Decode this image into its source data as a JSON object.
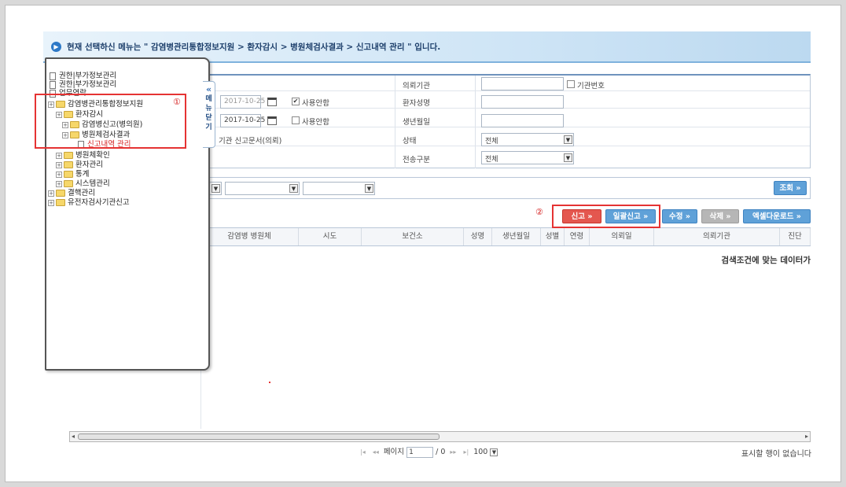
{
  "header": {
    "title": "현재 선택하신 메뉴는 \" 감염병관리통합정보지원 > 환자감시 > 병원체검사결과 > 신고내역 관리 \" 입니다."
  },
  "form": {
    "date1": "2017-10-25",
    "date2": "2017-10-25",
    "chk1_label": "사용안함",
    "chk2_label": "사용안함",
    "doc_label": "기관 신고문서(의뢰)",
    "fields": {
      "inst_label": "의뢰기관",
      "inst_code_label": "기관번호",
      "patient_name_label": "환자성명",
      "birth_label": "생년월일",
      "status_label": "상태",
      "status_value": "전체",
      "transfer_label": "전송구분",
      "transfer_value": "전체"
    }
  },
  "toolbar": {
    "search_label": "조회 »",
    "report_label": "신고 »",
    "batch_report_label": "일괄신고 »",
    "edit_label": "수정 »",
    "delete_label": "삭제 »",
    "excel_label": "엑셀다운로드 »"
  },
  "grid": {
    "columns": [
      "감염병 병원체",
      "시도",
      "보건소",
      "성명",
      "생년월일",
      "성별",
      "연령",
      "의뢰일",
      "의뢰기관",
      "진단"
    ],
    "empty_message": "검색조건에 맞는 데이터가"
  },
  "pager": {
    "page_label": "페이지",
    "page_value": "1",
    "total": "/ 0",
    "page_size": "100",
    "no_rows": "표시할 행이 없습니다"
  },
  "nav": {
    "items": [
      "권한|부가정보관리",
      "권한|부가정보관리",
      "업무연락",
      "감염병관리통합정보지원",
      "환자감시",
      "감염병신고(병의원)",
      "병원체검사결과",
      "신고내역 관리",
      "병원체확인",
      "환자관리",
      "통계",
      "시스템관리",
      "결핵관리",
      "유전자검사기관신고"
    ],
    "menu_tab_label": [
      "메",
      "뉴",
      "닫",
      "기"
    ],
    "menu_tab_arrow": "«"
  },
  "annotations": {
    "marker1": "①",
    "marker2": "②"
  },
  "colors": {
    "highlight": "#e53333",
    "accent": "#2d79c7",
    "active_item": "#d42020"
  }
}
